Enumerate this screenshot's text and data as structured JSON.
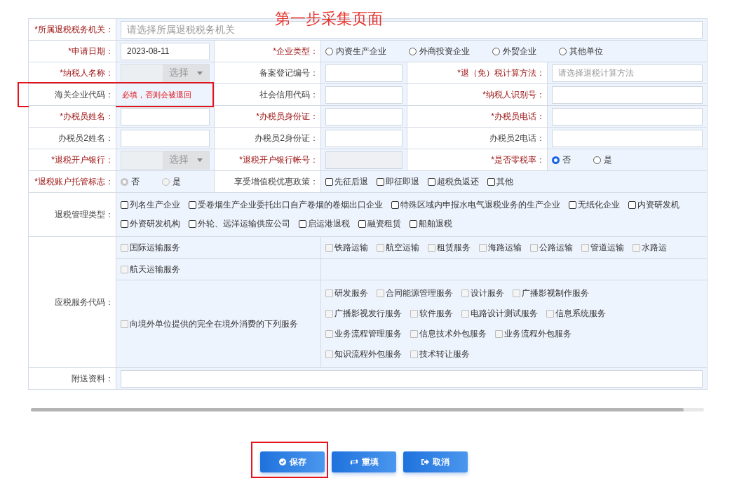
{
  "annotation": {
    "title": "第一步采集页面"
  },
  "rows": [
    {
      "kind": "full",
      "cells": [
        {
          "kind": "label",
          "text": "*所属退税税务机关：",
          "required": true
        },
        {
          "kind": "text",
          "placeholder": "请选择所属退税税务机关"
        }
      ]
    },
    {
      "kind": "split",
      "cells": [
        {
          "kind": "label",
          "text": "*申请日期：",
          "required": true
        },
        {
          "kind": "text",
          "value": "2023-08-11"
        },
        {
          "kind": "label",
          "text": "*企业类型：",
          "required": true
        },
        {
          "kind": "radio",
          "disabled": false,
          "options": [
            {
              "label": "内资生产企业",
              "selected": false
            },
            {
              "label": "外商投资企业",
              "selected": false
            },
            {
              "label": "外贸企业",
              "selected": false
            },
            {
              "label": "其他单位",
              "selected": false
            }
          ]
        }
      ]
    },
    {
      "kind": "triple",
      "cells": [
        {
          "kind": "label",
          "text": "*纳税人名称：",
          "required": true
        },
        {
          "kind": "select",
          "button": "选择",
          "disabled": true
        },
        {
          "kind": "label",
          "text": "备案登记编号：",
          "required": false
        },
        {
          "kind": "text"
        },
        {
          "kind": "label",
          "text": "*退（免）税计算方法：",
          "required": true
        },
        {
          "kind": "text",
          "placeholder": "请选择退税计算方法"
        }
      ]
    },
    {
      "kind": "triple",
      "cells": [
        {
          "kind": "label",
          "text": "海关企业代码：",
          "required": false,
          "highlighted": true
        },
        {
          "kind": "note",
          "text": "必填，否则会被退回"
        },
        {
          "kind": "label",
          "text": "社会信用代码：",
          "required": false
        },
        {
          "kind": "text"
        },
        {
          "kind": "label",
          "text": "*纳税人识别号：",
          "required": true
        },
        {
          "kind": "text"
        }
      ]
    },
    {
      "kind": "triple",
      "cells": [
        {
          "kind": "label",
          "text": "*办税员姓名：",
          "required": true
        },
        {
          "kind": "text"
        },
        {
          "kind": "label",
          "text": "*办税员身份证：",
          "required": true
        },
        {
          "kind": "text"
        },
        {
          "kind": "label",
          "text": "*办税员电话：",
          "required": true
        },
        {
          "kind": "text"
        }
      ]
    },
    {
      "kind": "triple",
      "cells": [
        {
          "kind": "label",
          "text": "办税员2姓名：",
          "required": false
        },
        {
          "kind": "text"
        },
        {
          "kind": "label",
          "text": "办税员2身份证：",
          "required": false
        },
        {
          "kind": "text"
        },
        {
          "kind": "label",
          "text": "办税员2电话：",
          "required": false
        },
        {
          "kind": "text"
        }
      ]
    },
    {
      "kind": "triple",
      "cells": [
        {
          "kind": "label",
          "text": "*退税开户银行：",
          "required": true
        },
        {
          "kind": "select",
          "button": "选择",
          "disabled": true
        },
        {
          "kind": "label",
          "text": "*退税开户银行帐号：",
          "required": true
        },
        {
          "kind": "text",
          "disabled": true
        },
        {
          "kind": "label",
          "text": "*是否零税率：",
          "required": true
        },
        {
          "kind": "radio",
          "disabled": false,
          "options": [
            {
              "label": "否",
              "selected": true
            },
            {
              "label": "是",
              "selected": false
            }
          ]
        }
      ]
    },
    {
      "kind": "split",
      "cells": [
        {
          "kind": "label",
          "text": "*退税账户托管标志：",
          "required": true
        },
        {
          "kind": "radio",
          "disabled": true,
          "options": [
            {
              "label": "否",
              "selected": true
            },
            {
              "label": "是",
              "selected": false
            }
          ]
        },
        {
          "kind": "label",
          "text": "享受增值税优惠政策：",
          "required": false
        },
        {
          "kind": "checkbox",
          "options": [
            {
              "label": "先征后退",
              "checked": false
            },
            {
              "label": "即征即退",
              "checked": false
            },
            {
              "label": "超税负返还",
              "checked": false
            },
            {
              "label": "其他",
              "checked": false
            }
          ]
        }
      ]
    },
    {
      "kind": "full",
      "cells": [
        {
          "kind": "label",
          "text": "退税管理类型：",
          "required": false
        },
        {
          "kind": "checkbox",
          "options": [
            {
              "label": "列名生产企业",
              "checked": false
            },
            {
              "label": "受卷烟生产企业委托出口自产卷烟的卷烟出口企业",
              "checked": false
            },
            {
              "label": "特殊区域内申报水电气退税业务的生产企业",
              "checked": false
            },
            {
              "label": "无纸化企业",
              "checked": false
            },
            {
              "label": "内资研发机",
              "checked": false
            },
            {
              "label": "外资研发机构",
              "checked": false
            },
            {
              "label": "外轮、远洋运输供应公司",
              "checked": false
            },
            {
              "label": "启运港退税",
              "checked": false
            },
            {
              "label": "融资租赁",
              "checked": false
            },
            {
              "label": "船舶退税",
              "checked": false
            }
          ]
        }
      ]
    },
    {
      "kind": "services",
      "label": "应税服务代码：",
      "disabled": true,
      "groups": [
        {
          "item": {
            "label": "国际运输服务",
            "checked": false
          },
          "options": [
            {
              "label": "铁路运输",
              "checked": false
            },
            {
              "label": "航空运输",
              "checked": false
            },
            {
              "label": "租赁服务",
              "checked": false
            },
            {
              "label": "海路运输",
              "checked": false
            },
            {
              "label": "公路运输",
              "checked": false
            },
            {
              "label": "管道运输",
              "checked": false
            },
            {
              "label": "水路运",
              "checked": false
            }
          ]
        },
        {
          "item": {
            "label": "航天运输服务",
            "checked": false
          }
        },
        {
          "item": {
            "label": "向境外单位提供的完全在境外消费的下列服务",
            "checked": false
          },
          "options": [
            {
              "label": "研发服务",
              "checked": false
            },
            {
              "label": "合同能源管理服务",
              "checked": false
            },
            {
              "label": "设计服务",
              "checked": false
            },
            {
              "label": "广播影视制作服务",
              "checked": false
            },
            {
              "label": "广播影视发行服务",
              "checked": false
            },
            {
              "label": "软件服务",
              "checked": false
            },
            {
              "label": "电路设计测试服务",
              "checked": false
            },
            {
              "label": "信息系统服务",
              "checked": false
            },
            {
              "label": "业务流程管理服务",
              "checked": false
            },
            {
              "label": "信息技术外包服务",
              "checked": false
            },
            {
              "label": "业务流程外包服务",
              "checked": false
            },
            {
              "label": "知识流程外包服务",
              "checked": false
            },
            {
              "label": "技术转让服务",
              "checked": false
            }
          ]
        }
      ]
    },
    {
      "kind": "full",
      "cells": [
        {
          "kind": "label",
          "text": "附送资料：",
          "required": false
        },
        {
          "kind": "text"
        }
      ]
    }
  ],
  "buttons": [
    {
      "label": "保存",
      "highlighted": true
    },
    {
      "label": "重填",
      "highlighted": false
    },
    {
      "label": "取消",
      "highlighted": false
    }
  ]
}
